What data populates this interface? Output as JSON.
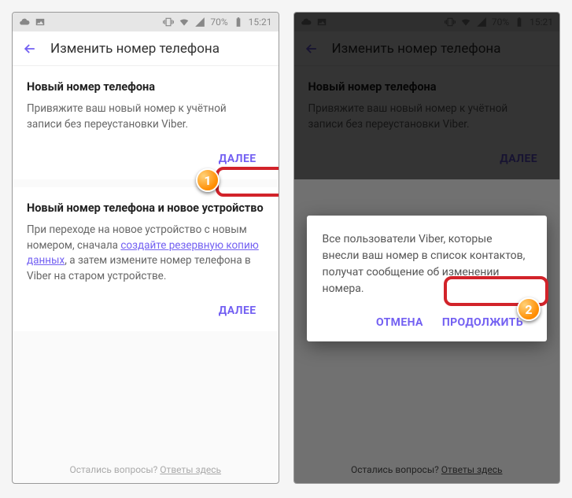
{
  "status": {
    "battery": "70%",
    "time": "15:21"
  },
  "appbar": {
    "title": "Изменить номер телефона"
  },
  "card1": {
    "title": "Новый номер телефона",
    "body": "Привяжите ваш новый номер к учётной записи без переустановки Viber.",
    "btn": "ДАЛЕЕ"
  },
  "card2": {
    "title": "Новый номер телефона и новое устройство",
    "body_pre": "При переходе на новое устройство с новым номером, сначала ",
    "body_link": "создайте резервную копию данных",
    "body_post": ", а затем измените номер телефона в Viber на старом устройстве.",
    "btn": "ДАЛЕЕ"
  },
  "footer": {
    "q": "Остались вопросы? ",
    "a": "Ответы здесь"
  },
  "dialog": {
    "body": "Все пользователи Viber, которые внесли ваш номер в список контактов, получат сообщение об изменении номера.",
    "cancel": "ОТМЕНА",
    "ok": "ПРОДОЛЖИТЬ"
  },
  "badges": {
    "one": "1",
    "two": "2"
  }
}
